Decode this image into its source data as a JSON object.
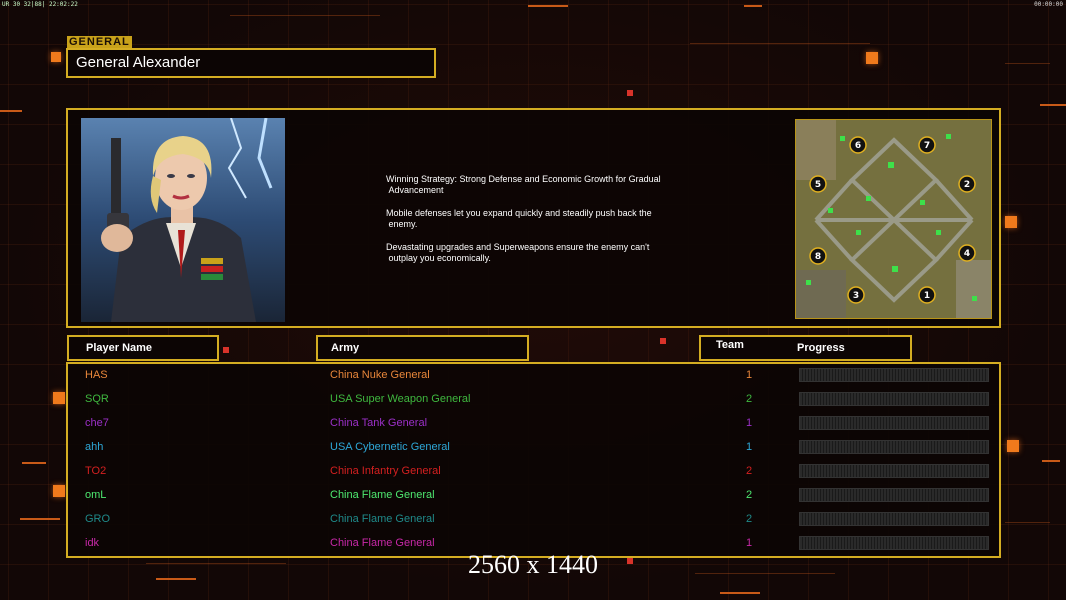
{
  "hud": {
    "left": "UR 30 32|88| 22:02:22",
    "right": "00:00:00"
  },
  "general": {
    "tag": "GENERAL",
    "name": "General Alexander"
  },
  "strategy": [
    "Winning Strategy: Strong Defense and Economic Growth for Gradual\n Advancement",
    "Mobile defenses let you expand quickly and steadily push back the\n enemy.",
    "Devastating upgrades and Superweapons ensure the enemy can't\n outplay you economically."
  ],
  "minimap": {
    "spawns": [
      "6",
      "7",
      "5",
      "2",
      "8",
      "4",
      "3",
      "1"
    ]
  },
  "table": {
    "headers": {
      "player": "Player Name",
      "army": "Army",
      "team": "Team",
      "progress": "Progress"
    },
    "rows": [
      {
        "player": "HAS",
        "army": "China Nuke General",
        "team": "1",
        "color": "#e8863a",
        "progress": 0
      },
      {
        "player": "SQR",
        "army": "USA Super Weapon General",
        "team": "2",
        "color": "#3fb83f",
        "progress": 0
      },
      {
        "player": "che7",
        "army": "China Tank General",
        "team": "1",
        "color": "#9b30c8",
        "progress": 0
      },
      {
        "player": "ahh",
        "army": "USA Cybernetic General",
        "team": "1",
        "color": "#2ea8d8",
        "progress": 0
      },
      {
        "player": "TO2",
        "army": "China Infantry General",
        "team": "2",
        "color": "#d42020",
        "progress": 0
      },
      {
        "player": "omL",
        "army": "China Flame General",
        "team": "2",
        "color": "#4ee870",
        "progress": 0
      },
      {
        "player": "GRO",
        "army": "China Flame General",
        "team": "2",
        "color": "#1f8a8a",
        "progress": 0
      },
      {
        "player": "idk",
        "army": "China Flame General",
        "team": "1",
        "color": "#c828a8",
        "progress": 0
      }
    ]
  },
  "resolution_label": "2560 x 1440"
}
